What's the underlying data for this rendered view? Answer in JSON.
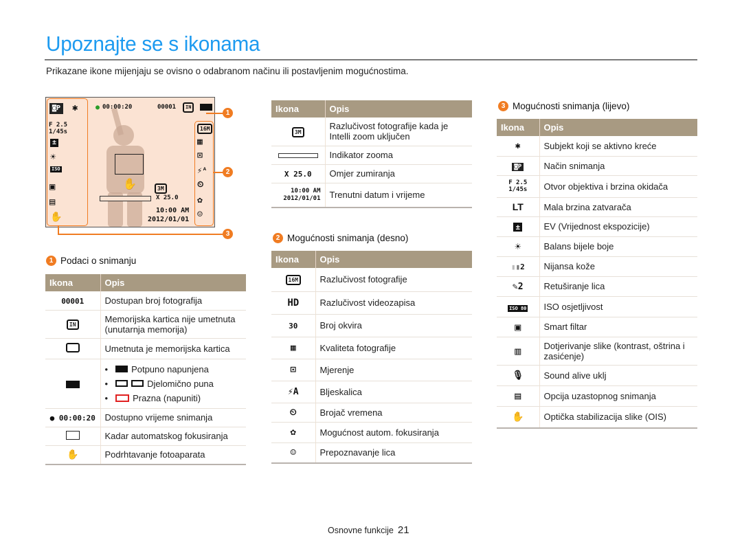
{
  "page": {
    "title": "Upoznajte se s ikonama",
    "intro": "Prikazane ikone mijenjaju se ovisno o odabranom načinu ili postavljenim mogućnostima.",
    "footer_label": "Osnovne funkcije",
    "page_number": "21",
    "accent_color": "#1e9bf0",
    "callout_color": "#f07c22",
    "table_header_color": "#a89a82"
  },
  "display": {
    "rec_time": "00:00:20",
    "shot_count": "00001",
    "memory_icon": "IN",
    "aperture": "F 2.5",
    "shutter": "1/45s",
    "zoom_ratio": "X 25.0",
    "time": "10:00 AM",
    "date": "2012/01/01",
    "resolution_small": "3M",
    "resolution": "16M",
    "callouts": [
      "1",
      "2",
      "3"
    ]
  },
  "common": {
    "col_icon": "Ikona",
    "col_desc": "Opis"
  },
  "section1": {
    "number": "1",
    "title": "Podaci o snimanju",
    "rows": [
      {
        "icon": "00001",
        "icon_name": "shot-count-icon",
        "desc": "Dostupan broj fotografija"
      },
      {
        "icon": "IN",
        "icon_name": "internal-memory-icon",
        "desc": "Memorijska kartica nije umetnuta (unutarnja memorija)"
      },
      {
        "icon": "card",
        "icon_name": "memory-card-icon",
        "desc": "Umetnuta je memorijska kartica"
      },
      {
        "icon": "battery",
        "icon_name": "battery-icon",
        "bullets": [
          "Potpuno napunjena",
          "Djelomično puna",
          "Prazna (napuniti)"
        ]
      },
      {
        "icon": "● 00:00:20",
        "icon_name": "record-time-icon",
        "desc": "Dostupno vrijeme snimanja"
      },
      {
        "icon": "frame",
        "icon_name": "af-frame-icon",
        "desc": "Kadar automatskog fokusiranja"
      },
      {
        "icon": "shake",
        "icon_name": "camera-shake-icon",
        "desc": "Podrhtavanje fotoaparata"
      }
    ]
  },
  "section_top_middle": {
    "rows": [
      {
        "icon": "3M",
        "icon_name": "intelli-zoom-resolution-icon",
        "desc": "Razlučivost fotografije kada je Intelli zoom uključen"
      },
      {
        "icon": "zoombar",
        "icon_name": "zoom-indicator-icon",
        "desc": "Indikator zooma"
      },
      {
        "icon": "X 25.0",
        "icon_name": "zoom-ratio-icon",
        "desc": "Omjer zumiranja"
      },
      {
        "icon": "10:00 AM 2012/01/01",
        "icon_name": "date-time-icon",
        "desc": "Trenutni datum i vrijeme"
      }
    ]
  },
  "section2": {
    "number": "2",
    "title": "Mogućnosti snimanja (desno)",
    "rows": [
      {
        "icon": "16M",
        "icon_name": "photo-resolution-icon",
        "desc": "Razlučivost fotografije"
      },
      {
        "icon": "HD",
        "icon_name": "video-resolution-icon",
        "desc": "Razlučivost videozapisa"
      },
      {
        "icon": "30",
        "icon_name": "frame-rate-icon",
        "desc": "Broj okvira"
      },
      {
        "icon": "F",
        "icon_name": "photo-quality-icon",
        "desc": "Kvaliteta fotografije"
      },
      {
        "icon": "⊡",
        "icon_name": "metering-icon",
        "desc": "Mjerenje"
      },
      {
        "icon": "⚡A",
        "icon_name": "flash-icon",
        "desc": "Bljeskalica"
      },
      {
        "icon": "⏲",
        "icon_name": "timer-icon",
        "desc": "Brojač vremena"
      },
      {
        "icon": "✿",
        "icon_name": "macro-focus-icon",
        "desc": "Mogućnost autom. fokusiranja"
      },
      {
        "icon": "☺",
        "icon_name": "face-detection-icon",
        "desc": "Prepoznavanje lica"
      }
    ]
  },
  "section3": {
    "number": "3",
    "title": "Mogućnosti snimanja (lijevo)",
    "rows": [
      {
        "icon": "🏃",
        "icon_name": "active-subject-icon",
        "desc": "Subjekt koji se aktivno kreće"
      },
      {
        "icon": "📷P",
        "icon_name": "shooting-mode-icon",
        "desc": "Način snimanja"
      },
      {
        "icon": "F 2.5 1/45s",
        "icon_name": "aperture-shutter-icon",
        "desc": "Otvor objektiva i brzina okidača"
      },
      {
        "icon": "LT",
        "icon_name": "long-time-icon",
        "desc": "Mala brzina zatvarača"
      },
      {
        "icon": "±",
        "icon_name": "ev-icon",
        "desc": "EV (Vrijednost ekspozicije)"
      },
      {
        "icon": "☀",
        "icon_name": "white-balance-icon",
        "desc": "Balans bijele boje"
      },
      {
        "icon": "2",
        "icon_name": "skin-tone-icon",
        "desc": "Nijansa kože"
      },
      {
        "icon": "✎2",
        "icon_name": "face-retouch-icon",
        "desc": "Retuširanje lica"
      },
      {
        "icon": "ISO 80",
        "icon_name": "iso-icon",
        "desc": "ISO osjetljivost"
      },
      {
        "icon": "▣",
        "icon_name": "smart-filter-icon",
        "desc": "Smart filtar"
      },
      {
        "icon": "▥",
        "icon_name": "image-adjust-icon",
        "desc": "Dotjerivanje slike (kontrast, oštrina i zasićenje)"
      },
      {
        "icon": "🎙",
        "icon_name": "sound-alive-icon",
        "desc": "Sound alive uklj"
      },
      {
        "icon": "▤",
        "icon_name": "burst-icon",
        "desc": "Opcija uzastopnog snimanja"
      },
      {
        "icon": "✋",
        "icon_name": "ois-icon",
        "desc": "Optička stabilizacija slike (OIS)"
      }
    ]
  }
}
